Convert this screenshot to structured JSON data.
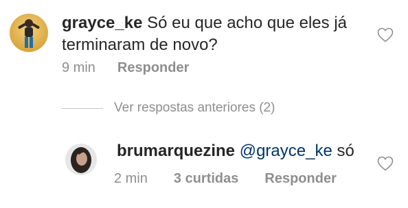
{
  "comments": [
    {
      "username": "grayce_ke",
      "text": "Só eu que acho que eles já terminaram de novo?",
      "time": "9 min",
      "reply_label": "Responder",
      "liked": false
    },
    {
      "username": "brumarquezine",
      "mention": "@grayce_ke",
      "text": "só",
      "time": "2 min",
      "likes_label": "3 curtidas",
      "reply_label": "Responder",
      "liked": false
    }
  ],
  "view_previous_replies": "Ver respostas anteriores (2)",
  "icons": {
    "like": "heart-outline-icon"
  },
  "colors": {
    "text": "#262626",
    "secondary": "#8e8e8e",
    "mention": "#003569"
  }
}
